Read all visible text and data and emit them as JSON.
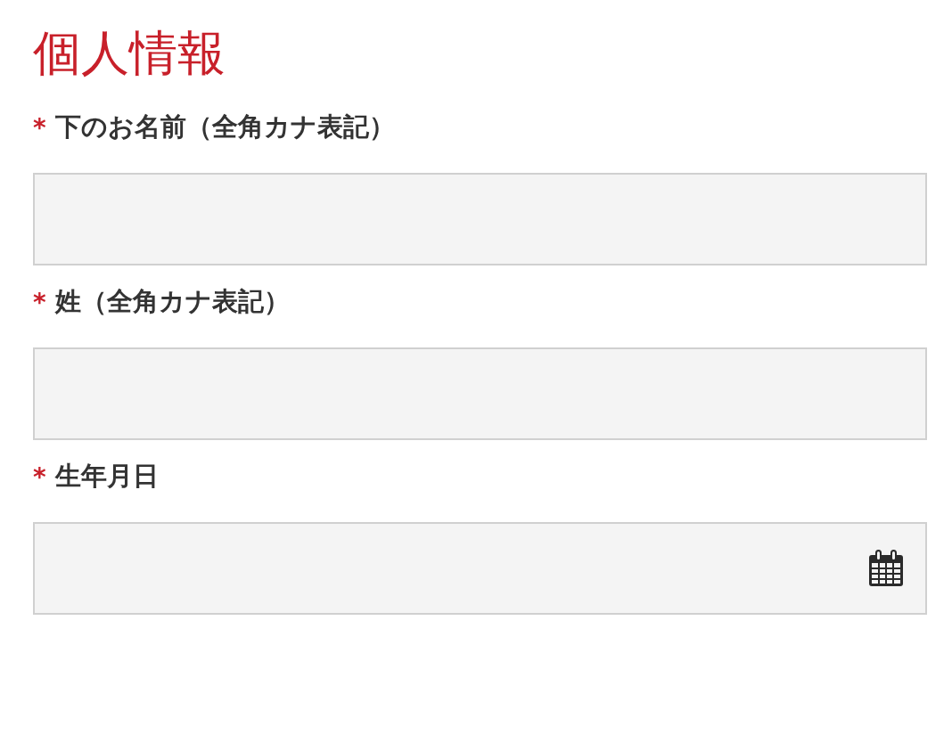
{
  "heading": "個人情報",
  "fields": [
    {
      "mark": "*",
      "label": "下のお名前（全角カナ表記）",
      "kind": "text"
    },
    {
      "mark": "*",
      "label": "姓（全角カナ表記）",
      "kind": "text"
    },
    {
      "mark": "*",
      "label": "生年月日",
      "kind": "date"
    }
  ]
}
